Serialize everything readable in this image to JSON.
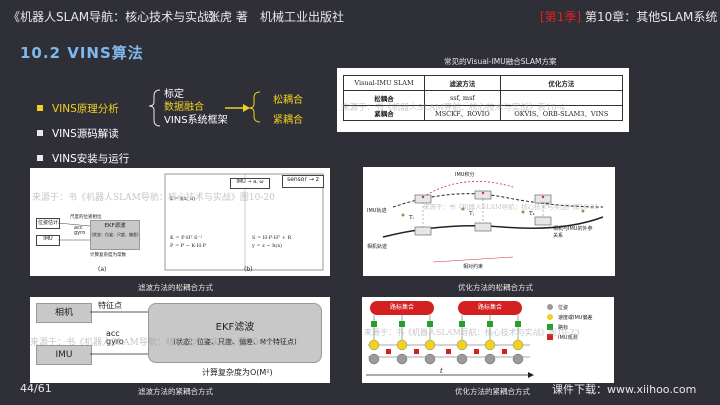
{
  "header": {
    "book": "《机器人SLAM导航：核心技术与实战》",
    "author": "张虎 著",
    "publisher": "机械工业出版社",
    "season": "[第1季]",
    "chapter": "第10章：其他SLAM系统"
  },
  "section_title": "10.2 VINS算法",
  "bullets": [
    {
      "label": "VINS原理分析"
    },
    {
      "label": "VINS源码解读"
    },
    {
      "label": "VINS安装与运行"
    }
  ],
  "tree": {
    "mid": [
      "标定",
      "数据融合",
      "VINS系统框架"
    ],
    "right": [
      "松耦合",
      "紧耦合"
    ]
  },
  "table_panel": {
    "caption": "常见的Visual-IMU融合SLAM方案",
    "headers": [
      "Visual-IMU SLAM",
      "滤波方法",
      "优化方法"
    ],
    "rows": [
      {
        "name": "松耦合",
        "filter": "ssf, msf",
        "optim": ""
      },
      {
        "name": "紧耦合",
        "filter": "MSCKF、ROVIO",
        "optim": "OKVIS、ORB-SLAM3、VINS"
      }
    ],
    "watermark": "来源于：书《机器人SLAM导航：核心技术与实战》表10-4"
  },
  "panel_loose_filter": {
    "caption": "滤波方法的松耦合方式",
    "watermark": "来源于：书《机器人SLAM导航：核心技术与实战》图10-20",
    "sub_a": "(a)",
    "sub_b": "(b)",
    "visual_label": "位姿估计",
    "imu_label": "IMU",
    "acc_gyro": "acc\ngyro",
    "ekf_label": "EKF滤波",
    "ekf_detail": "(状态：位姿、尺度、偏差)",
    "complexity": "计算复杂度为常数",
    "scaled_pose": "尺度的位姿相位",
    "sensor_label": "sensor → z",
    "imu_box": "IMU → a, ω",
    "state_eq": "x̂ = f(x, u)",
    "eqs": [
      "K = P·Hᵀ·S⁻¹",
      "P = P − K·H·P",
      "S = H·P·Hᵀ + R",
      "y = z − h(x)"
    ]
  },
  "panel_loose_optim": {
    "caption": "优化方法的松耦合方式",
    "watermark": "来源于：书《机器人SLAM导航：核心技术与实战》图10-21",
    "imu_integral": "IMU积分",
    "imu_traj": "IMU轨迹",
    "camera_traj": "相机轨迹",
    "relative_constraint": "相对约束",
    "camera_imu": "相机与IMU的外参关系",
    "t_labels": [
      "Tᵢ",
      "Tⱼ",
      "Tₖ"
    ]
  },
  "panel_tight_filter": {
    "caption": "滤波方法的紧耦合方式",
    "watermark": "来源于：书《机器人SLAM导航：核心技术与实战》图10-22",
    "camera": "相机",
    "imu": "IMU",
    "feature": "特征点",
    "acc_gyro": "acc\ngyro",
    "ekf_label": "EKF滤波",
    "ekf_detail": "(状态：位姿、尺度、偏差、M个特征点)",
    "complexity": "计算复杂度为O(M²)"
  },
  "panel_tight_optim": {
    "caption": "优化方法的紧耦合方式",
    "watermark": "来源于：书《机器人SLAM导航：核心技术与实战》图10-23",
    "landmark_sets": [
      "路标集合",
      "路标集合"
    ],
    "legend": [
      "位姿",
      "速度或IMU偏差",
      "路标",
      "IMU观测"
    ],
    "axis_t": "t"
  },
  "footer": {
    "page": "44/61",
    "download": "课件下载：www.xiihoo.com"
  },
  "colors": {
    "accent": "#f0d020",
    "title": "#7fb8ec",
    "red": "#e02020",
    "bg": "#2f2f38"
  }
}
